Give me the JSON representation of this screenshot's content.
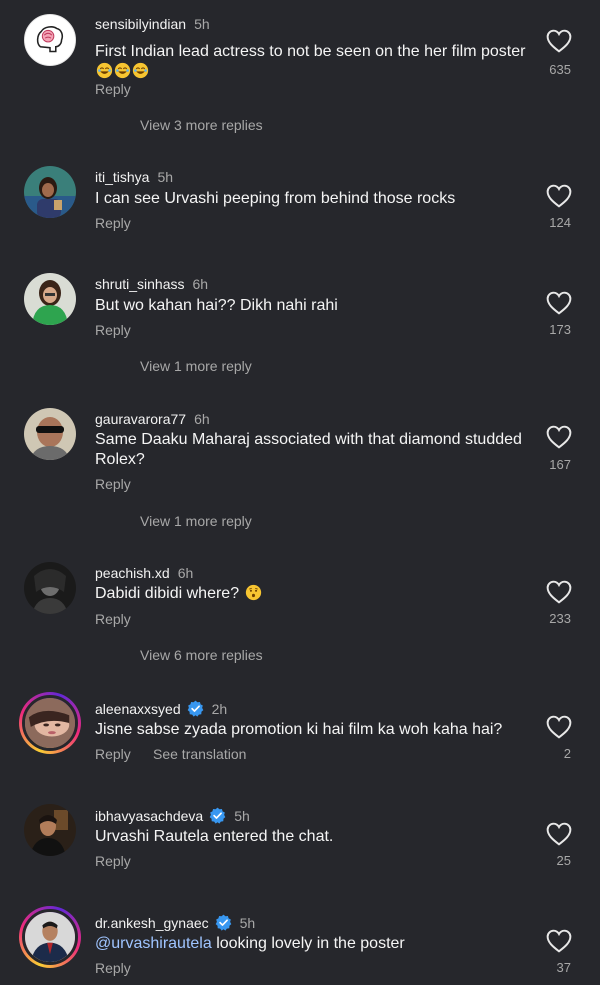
{
  "comments": [
    {
      "username": "sensibilyindian",
      "time": "5h",
      "verified": false,
      "text": "First Indian lead actress to not be seen on the her film poster",
      "emoji_suffix": [
        "joy-emoji",
        "joy-emoji",
        "joy-emoji"
      ],
      "reply_label": "Reply",
      "likes": "635",
      "view_more": "View 3 more replies",
      "avatar_icon": "brain-icon"
    },
    {
      "username": "iti_tishya",
      "time": "5h",
      "verified": false,
      "text": "I can see Urvashi peeping from behind those rocks",
      "reply_label": "Reply",
      "likes": "124",
      "avatar_icon": "photo-avatar"
    },
    {
      "username": "shruti_sinhass",
      "time": "6h",
      "verified": false,
      "text": "But wo kahan hai?? Dikh nahi rahi",
      "reply_label": "Reply",
      "likes": "173",
      "view_more": "View 1 more reply",
      "avatar_icon": "photo-avatar"
    },
    {
      "username": "gauravarora77",
      "time": "6h",
      "verified": false,
      "text": "Same Daaku Maharaj associated with that diamond studded Rolex?",
      "reply_label": "Reply",
      "likes": "167",
      "view_more": "View 1 more reply",
      "avatar_icon": "photo-avatar"
    },
    {
      "username": "peachish.xd",
      "time": "6h",
      "verified": false,
      "text": "Dabidi dibidi where?",
      "emoji_suffix": [
        "hushed-emoji"
      ],
      "reply_label": "Reply",
      "likes": "233",
      "view_more": "View 6 more replies",
      "avatar_icon": "photo-avatar"
    },
    {
      "username": "aleenaxxsyed",
      "time": "2h",
      "verified": true,
      "text": "Jisne sabse zyada promotion ki hai film ka woh kaha hai?",
      "reply_label": "Reply",
      "translate_label": "See translation",
      "likes": "2",
      "avatar_icon": "photo-avatar"
    },
    {
      "username": "ibhavyasachdeva",
      "time": "5h",
      "verified": true,
      "text": "Urvashi Rautela entered the chat.",
      "reply_label": "Reply",
      "likes": "25",
      "avatar_icon": "photo-avatar"
    },
    {
      "username": "dr.ankesh_gynaec",
      "time": "5h",
      "verified": true,
      "mention": "@urvashirautela",
      "text": " looking lovely in the poster",
      "reply_label": "Reply",
      "likes": "37",
      "avatar_icon": "photo-avatar"
    }
  ],
  "colors": {
    "background": "#26272c",
    "secondary_text": "#a8a8a8",
    "mention": "#9fc4ff",
    "verified": "#3897f0"
  },
  "icons": {
    "like": "heart-outline-icon",
    "verified": "verified-badge-icon"
  }
}
